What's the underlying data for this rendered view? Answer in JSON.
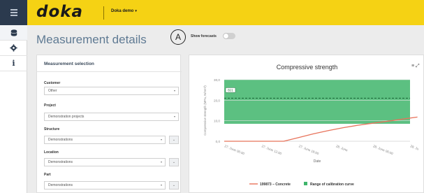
{
  "app": {
    "logo": "doka",
    "workspace": "Doka demo",
    "workspace_caret": "▾"
  },
  "sidebar": {
    "items": [
      {
        "icon": "database-icon"
      },
      {
        "icon": "settings-icon"
      },
      {
        "icon": "info-icon",
        "glyph": "i"
      }
    ]
  },
  "header": {
    "title": "Measurement details",
    "annotation": "A",
    "forecast_label": "Show forecasts",
    "forecast_enabled": false
  },
  "selection": {
    "title": "Measurement selection",
    "fields": [
      {
        "label": "Customer",
        "value": "Other"
      },
      {
        "label": "Project",
        "value": "Demonstration projects"
      },
      {
        "label": "Structure",
        "value": "Demonstrations"
      },
      {
        "label": "Location",
        "value": "Demonstrations"
      },
      {
        "label": "Part",
        "value": "Demonstrations"
      }
    ],
    "arrow_glyph": "▾",
    "chevron_glyph": "⌄"
  },
  "chart_data": {
    "type": "line",
    "title": "Compressive strength",
    "ylabel": "Compressive strength (MPa, N/mm²)",
    "xlabel": "Date",
    "ylim": [
      0,
      30
    ],
    "yticks": [
      "0,0",
      "10,0",
      "20,0",
      "30,0"
    ],
    "xticks": [
      "27. June 06:00",
      "27. June 12:00",
      "27. June 18:00",
      "28. June",
      "28. June 06:00",
      "28. Ju"
    ],
    "band": {
      "name": "Range of calibration curve",
      "from": 8.5,
      "to": 30,
      "color": "#3fb56b"
    },
    "target_line": {
      "label": "B21",
      "value": 21
    },
    "series": [
      {
        "name": "199873 – Concrete",
        "color": "#e8735b",
        "x": [
          0,
          1,
          1.6,
          2,
          2.4,
          2.8,
          3.2,
          3.6,
          4,
          4.4,
          4.8,
          5.2
        ],
        "values": [
          0,
          0,
          0,
          1.8,
          3.6,
          5.2,
          6.6,
          7.8,
          8.8,
          9.8,
          10.8,
          11.8
        ]
      }
    ],
    "legend_position": "bottom-center",
    "grid": true,
    "tools_glyph": "≡ ⤢"
  },
  "colors": {
    "brand_yellow": "#f5d214",
    "nav_dark": "#2b3a4e",
    "title_blue": "#5f7a93"
  }
}
